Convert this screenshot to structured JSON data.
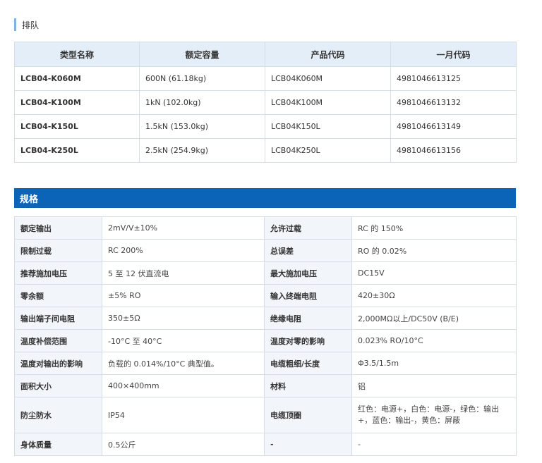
{
  "section1": {
    "title": "排队"
  },
  "ranking_table": {
    "headers": [
      "类型名称",
      "额定容量",
      "产品代码",
      "一月代码"
    ],
    "rows": [
      [
        "LCB04-K060M",
        "600N (61.18kg)",
        "LCB04K060M",
        "4981046613125"
      ],
      [
        "LCB04-K100M",
        "1kN (102.0kg)",
        "LCB04K100M",
        "4981046613132"
      ],
      [
        "LCB04-K150L",
        "1.5kN (153.0kg)",
        "LCB04K150L",
        "4981046613149"
      ],
      [
        "LCB04-K250L",
        "2.5kN (254.9kg)",
        "LCB04K250L",
        "4981046613156"
      ]
    ]
  },
  "section2": {
    "title": "规格"
  },
  "spec_table": {
    "rows": [
      [
        "额定输出",
        "2mV/V±10%",
        "允许过载",
        "RC 的 150%"
      ],
      [
        "限制过载",
        "RC 200%",
        "总误差",
        "RO 的 0.02%"
      ],
      [
        "推荐施加电压",
        "5 至 12 伏直流电",
        "最大施加电压",
        "DC15V"
      ],
      [
        "零余额",
        "±5% RO",
        "输入终端电阻",
        "420±30Ω"
      ],
      [
        "输出端子间电阻",
        "350±5Ω",
        "绝缘电阻",
        "2,000MΩ以上/DC50V (B/E)"
      ],
      [
        "温度补偿范围",
        "-10°C 至 40°C",
        "温度对零的影响",
        "0.023% RO/10°C"
      ],
      [
        "温度对输出的影响",
        "负载的 0.014%/10°C 典型值。",
        "电缆粗细/长度",
        "Φ3.5/1.5m"
      ],
      [
        "面积大小",
        "400×400mm",
        "材料",
        "铝"
      ],
      [
        "防尘防水",
        "IP54",
        "电缆顶圈",
        "红色：电源+，白色：电源-，绿色：输出+，蓝色：输出-，黄色：屏蔽"
      ],
      [
        "身体质量",
        "0.5公斤",
        "-",
        "-"
      ]
    ]
  }
}
